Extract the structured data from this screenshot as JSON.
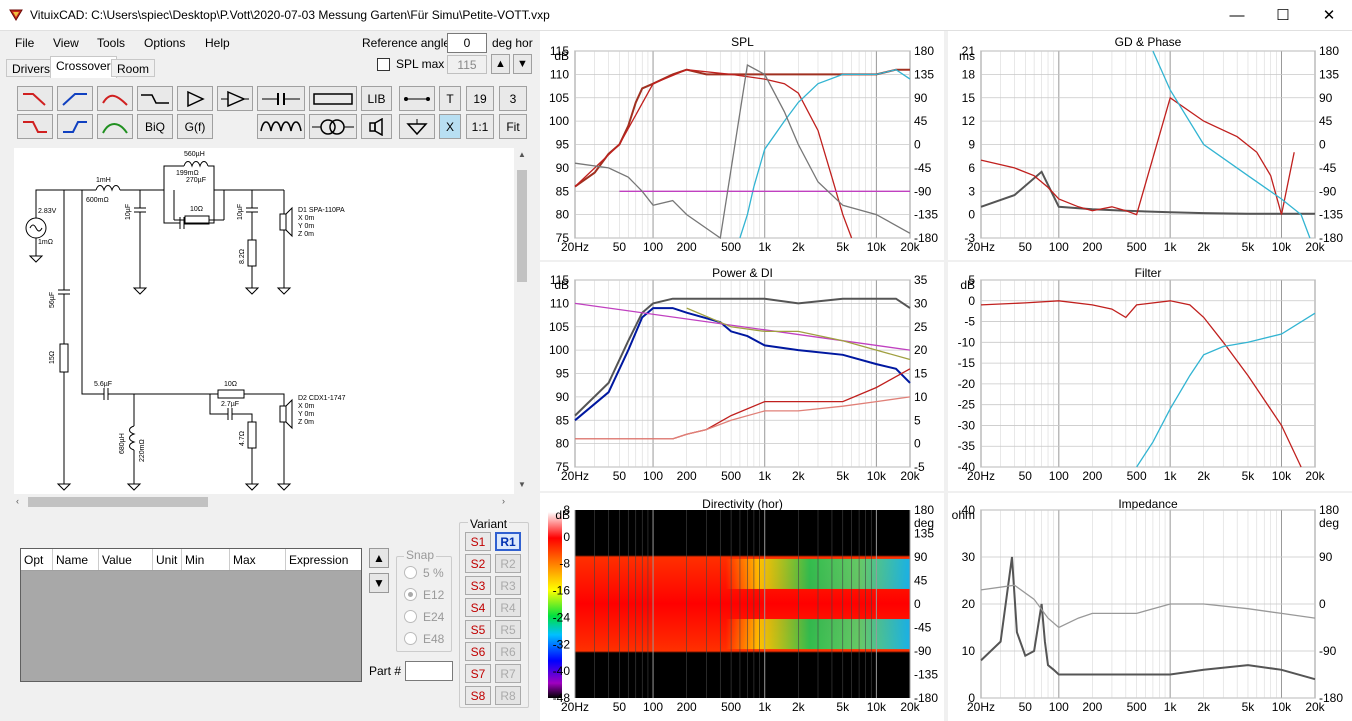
{
  "window": {
    "title": "VituixCAD: C:\\Users\\spiec\\Desktop\\P.Vott\\2020-07-03 Messung Garten\\Für Simu\\Petite-VOTT.vxp"
  },
  "menu": [
    "File",
    "View",
    "Tools",
    "Options",
    "Help"
  ],
  "tabs": [
    "Drivers",
    "Crossover",
    "Room"
  ],
  "reference": {
    "label": "Reference angle",
    "value": "0",
    "unit": "deg hor"
  },
  "splmax": {
    "label": "SPL max",
    "value": "115"
  },
  "toolbar": {
    "lib": "LIB",
    "t": "T",
    "n19": "19",
    "n3": "3",
    "biq": "BiQ",
    "gf": "G(f)",
    "x": "X",
    "ratio": "1:1",
    "fit": "Fit"
  },
  "schematic": {
    "labels": {
      "l1": "1mH",
      "l1r": "600mΩ",
      "v": "2.83V",
      "rs": "1mΩ",
      "c1": "10µF",
      "l2": "560µH",
      "l2r": "199mΩ",
      "c2": "270µF",
      "r2": "10Ω",
      "c3": "10µF",
      "r3": "8.2Ω",
      "d1": "D1 SPA-110PA",
      "x0": "X 0m",
      "y0": "Y 0m",
      "z0": "Z 0m",
      "c4": "56µF",
      "r4": "15Ω",
      "c5": "5.6µF",
      "l3": "680µH",
      "l3r": "220mΩ",
      "r5": "10Ω",
      "c6": "2.7µF",
      "r6": "4.7Ω",
      "d2": "D2 CDX1-1747"
    }
  },
  "opt_table": {
    "headers": [
      "Opt",
      "Name",
      "Value",
      "Unit",
      "Min",
      "Max",
      "Expression"
    ]
  },
  "snap": {
    "title": "Snap",
    "options": [
      "5 %",
      "E12",
      "E24",
      "E48"
    ],
    "selected": "E12"
  },
  "part": {
    "label": "Part #"
  },
  "variant": {
    "title": "Variant",
    "s": [
      "S1",
      "S2",
      "S3",
      "S4",
      "S5",
      "S6",
      "S7",
      "S8"
    ],
    "r": [
      "R1",
      "R2",
      "R3",
      "R4",
      "R5",
      "R6",
      "R7",
      "R8"
    ],
    "active": "R1"
  },
  "colors": {
    "driver_red": "#c0201e",
    "driver_cyan": "#32b4d2",
    "sum": "#a03020",
    "gray": "#555555",
    "magenta": "#c040c0",
    "di_blue": "#0018a0"
  },
  "xaxis": {
    "ticks": [
      "20Hz",
      "50",
      "100",
      "200",
      "500",
      "1k",
      "2k",
      "5k",
      "10k",
      "20k"
    ]
  },
  "panels": {
    "spl": {
      "title": "SPL",
      "yl_unit": "dB",
      "yl_ticks": [
        "115",
        "110",
        "105",
        "100",
        "95",
        "90",
        "85",
        "80",
        "75"
      ],
      "yr_unit": "",
      "yr_ticks": [
        "180",
        "135",
        "90",
        "45",
        "0",
        "-45",
        "-90",
        "-135",
        "-180"
      ]
    },
    "gd": {
      "title": "GD & Phase",
      "yl_unit": "ms",
      "yl_ticks": [
        "21",
        "18",
        "15",
        "12",
        "9",
        "6",
        "3",
        "0",
        "-3"
      ],
      "yr_unit": "",
      "yr_ticks": [
        "180",
        "135",
        "90",
        "45",
        "0",
        "-45",
        "-90",
        "-135",
        "-180"
      ]
    },
    "power": {
      "title": "Power & DI",
      "yl_unit": "dB",
      "yl_ticks": [
        "115",
        "110",
        "105",
        "100",
        "95",
        "90",
        "85",
        "80",
        "75"
      ],
      "yr_unit": "",
      "yr_ticks": [
        "35",
        "30",
        "25",
        "20",
        "15",
        "10",
        "5",
        "0",
        "-5"
      ]
    },
    "filter": {
      "title": "Filter",
      "yl_unit": "dB",
      "yl_ticks": [
        "5",
        "0",
        "-5",
        "-10",
        "-15",
        "-20",
        "-25",
        "-30",
        "-35",
        "-40"
      ],
      "yr_unit": "",
      "yr_ticks": []
    },
    "dir": {
      "title": "Directivity (hor)",
      "yl_unit": "dB",
      "yl_ticks": [
        "8",
        "0",
        "-8",
        "-16",
        "-24",
        "-32",
        "-40",
        "-48"
      ],
      "yr_unit": "deg",
      "yr_ticks": [
        "180",
        "135",
        "90",
        "45",
        "0",
        "-45",
        "-90",
        "-135",
        "-180"
      ]
    },
    "imp": {
      "title": "Impedance",
      "yl_unit": "ohm",
      "yl_ticks": [
        "40",
        "30",
        "20",
        "10",
        "0"
      ],
      "yr_unit": "deg",
      "yr_ticks": [
        "180",
        "90",
        "0",
        "-90",
        "-180"
      ]
    }
  },
  "chart_data": [
    {
      "type": "line",
      "title": "SPL",
      "xscale": "log",
      "xlim": [
        20,
        20000
      ],
      "ylim": [
        75,
        115
      ],
      "ylabel": "dB",
      "grid": true,
      "series": [
        {
          "color": "#a03020",
          "x": [
            20,
            30,
            40,
            50,
            60,
            70,
            80,
            100,
            150,
            200,
            300,
            500,
            700,
            1000,
            2000,
            3000,
            5000,
            10000,
            15000,
            20000
          ],
          "y": [
            86,
            89,
            93,
            95,
            99,
            104,
            107,
            108,
            110,
            111,
            110,
            110,
            110,
            110,
            110,
            110,
            110,
            110,
            111,
            111
          ]
        },
        {
          "color": "#c0201e",
          "x": [
            20,
            50,
            100,
            200,
            500,
            1000,
            1500,
            2000,
            3000,
            4000,
            5000,
            6000
          ],
          "y": [
            86,
            95,
            108,
            111,
            110,
            109,
            108,
            106,
            98,
            88,
            80,
            73
          ]
        },
        {
          "color": "#32b4d2",
          "x": [
            600,
            700,
            800,
            1000,
            1500,
            2000,
            3000,
            5000,
            10000,
            15000,
            20000
          ],
          "y": [
            75,
            80,
            86,
            94,
            100,
            104,
            108,
            110,
            110,
            111,
            109
          ]
        },
        {
          "color": "#c040c0",
          "x": [
            50,
            20000
          ],
          "y": [
            85,
            85
          ]
        },
        {
          "color": "#777777",
          "x": [
            20,
            40,
            60,
            80,
            100,
            150,
            200,
            400,
            700,
            1000,
            1500,
            2000,
            3000,
            5000,
            10000,
            20000
          ],
          "y": [
            91,
            90,
            88,
            85,
            82,
            83,
            80,
            75,
            112,
            110,
            102,
            95,
            87,
            82,
            80,
            76
          ]
        }
      ]
    },
    {
      "type": "line",
      "title": "GD & Phase",
      "xscale": "log",
      "xlim": [
        20,
        20000
      ],
      "ylim": [
        -3,
        21
      ],
      "ylabel": "ms",
      "grid": true,
      "series": [
        {
          "color": "#555555",
          "x": [
            20,
            40,
            70,
            100,
            200,
            400,
            1000,
            2000,
            5000,
            20000
          ],
          "y": [
            1,
            2.5,
            5.5,
            1,
            0.7,
            0.5,
            0.3,
            0.2,
            0.1,
            0.1
          ]
        },
        {
          "color": "#c0201e",
          "x": [
            20,
            40,
            60,
            80,
            100,
            150,
            200,
            300,
            400,
            500,
            1000,
            2000,
            4000,
            6000,
            8000,
            10000,
            13000
          ],
          "y": [
            7,
            6,
            5,
            3.5,
            2,
            1,
            0.5,
            1,
            0.5,
            0,
            15,
            12,
            10,
            8,
            5,
            0,
            8
          ]
        },
        {
          "color": "#32b4d2",
          "x": [
            700,
            1000,
            2000,
            5000,
            10000,
            15000,
            18000
          ],
          "y": [
            21,
            16,
            9,
            5,
            2,
            0,
            -3
          ]
        }
      ]
    },
    {
      "type": "line",
      "title": "Power & DI",
      "xscale": "log",
      "xlim": [
        20,
        20000
      ],
      "ylim": [
        75,
        115
      ],
      "ylabel": "dB",
      "grid": true,
      "series": [
        {
          "color": "#555555",
          "x": [
            20,
            40,
            60,
            80,
            100,
            150,
            200,
            500,
            1000,
            2000,
            5000,
            10000,
            15000,
            20000
          ],
          "y": [
            86,
            93,
            102,
            108,
            110,
            111,
            111,
            111,
            111,
            110,
            111,
            111,
            111,
            109
          ]
        },
        {
          "color": "#0018a0",
          "x": [
            20,
            40,
            60,
            80,
            100,
            150,
            200,
            400,
            500,
            700,
            1000,
            2000,
            5000,
            10000,
            15000,
            20000
          ],
          "y": [
            85,
            91,
            100,
            107,
            109,
            109,
            108,
            106,
            104,
            103,
            101,
            100,
            99,
            97,
            96,
            93
          ]
        },
        {
          "color": "#c040c0",
          "x": [
            20,
            20000
          ],
          "y": [
            110,
            100
          ]
        },
        {
          "color": "#a0a040",
          "x": [
            200,
            500,
            1000,
            2000,
            5000,
            10000,
            20000
          ],
          "y": [
            109,
            105,
            104,
            104,
            102,
            100,
            98
          ]
        },
        {
          "color": "#c0201e",
          "x": [
            20,
            150,
            200,
            300,
            500,
            1000,
            2000,
            5000,
            10000,
            20000
          ],
          "y": [
            81,
            81,
            82,
            83,
            86,
            89,
            89,
            89,
            92,
            96
          ]
        },
        {
          "color": "#e08078",
          "x": [
            20,
            150,
            200,
            300,
            500,
            1000,
            2000,
            5000,
            10000,
            20000
          ],
          "y": [
            81,
            81,
            82,
            83,
            85,
            87,
            87,
            88,
            89,
            90
          ]
        }
      ]
    },
    {
      "type": "line",
      "title": "Filter",
      "xscale": "log",
      "xlim": [
        20,
        20000
      ],
      "ylim": [
        -40,
        5
      ],
      "ylabel": "dB",
      "grid": true,
      "series": [
        {
          "color": "#c0201e",
          "x": [
            20,
            50,
            100,
            200,
            300,
            400,
            500,
            1000,
            1500,
            2000,
            3000,
            5000,
            10000,
            15000
          ],
          "y": [
            -1,
            -0.5,
            0,
            -1,
            -2,
            -4,
            -1,
            0,
            -1,
            -4,
            -10,
            -18,
            -30,
            -40
          ]
        },
        {
          "color": "#32b4d2",
          "x": [
            500,
            700,
            1000,
            1500,
            2000,
            3000,
            5000,
            10000,
            20000
          ],
          "y": [
            -40,
            -34,
            -26,
            -18,
            -13,
            -11,
            -10,
            -8,
            -3
          ]
        }
      ]
    },
    {
      "type": "heatmap",
      "title": "Directivity (hor)",
      "xscale": "log",
      "xlim": [
        20,
        20000
      ],
      "ylim": [
        -180,
        180
      ],
      "zlim": [
        -48,
        8
      ]
    },
    {
      "type": "line",
      "title": "Impedance",
      "xscale": "log",
      "xlim": [
        20,
        20000
      ],
      "ylim": [
        0,
        40
      ],
      "ylabel": "ohm",
      "grid": true,
      "series": [
        {
          "color": "#555555",
          "x": [
            20,
            30,
            38,
            42,
            50,
            60,
            70,
            75,
            80,
            90,
            100,
            200,
            500,
            1000,
            2000,
            5000,
            10000,
            20000
          ],
          "y": [
            8,
            12,
            30,
            14,
            9,
            10,
            20,
            12,
            7,
            6,
            5,
            5,
            5,
            5,
            6,
            7,
            6,
            4
          ]
        },
        {
          "color": "#999999",
          "x": [
            20,
            40,
            60,
            80,
            100,
            150,
            200,
            500,
            1000,
            2000,
            5000,
            10000,
            20000
          ],
          "y": [
            23,
            24,
            21,
            17,
            15,
            17,
            18,
            18,
            20,
            20,
            19,
            18,
            17
          ]
        }
      ]
    }
  ]
}
